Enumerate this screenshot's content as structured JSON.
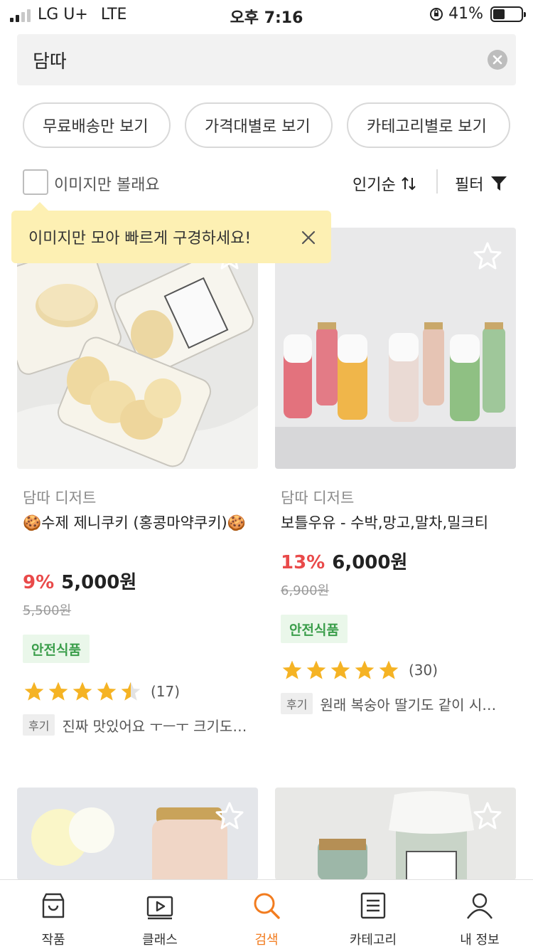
{
  "status_bar": {
    "carrier": "LG U+",
    "network": "LTE",
    "time": "오후 7:16",
    "battery_pct": "41%",
    "battery_level": 0.41
  },
  "search": {
    "value": "담따"
  },
  "chips": [
    {
      "label": "무료배송만 보기"
    },
    {
      "label": "가격대별로 보기"
    },
    {
      "label": "카테고리별로 보기"
    }
  ],
  "options": {
    "only_images_label": "이미지만 볼래요",
    "sort_label": "인기순",
    "filter_label": "필터"
  },
  "tooltip": {
    "text": "이미지만 모아 빠르게 구경하세요!"
  },
  "products": [
    {
      "seller": "담따 디저트",
      "name": "🍪수제 제니쿠키 (홍콩마약쿠키)🍪",
      "discount": "9%",
      "price": "5,000원",
      "original_price": "5,500원",
      "badge": "안전식품",
      "rating": 4.5,
      "rating_count": "(17)",
      "review_tag": "후기",
      "review_text": "진짜 맛있어요 ㅜㅡㅜ 크기도 크고 너무 맛있어요"
    },
    {
      "seller": "담따 디저트",
      "name": "보틀우유 - 수박,망고,말차,밀크티",
      "discount": "13%",
      "price": "6,000원",
      "original_price": "6,900원",
      "badge": "안전식품",
      "rating": 5,
      "rating_count": "(30)",
      "review_tag": "후기",
      "review_text": "원래 복숭아 딸기도 같이 시켰는데 너무 맛있어요"
    }
  ],
  "tabbar": [
    {
      "label": "작품",
      "icon": "shop-icon"
    },
    {
      "label": "클래스",
      "icon": "play-icon"
    },
    {
      "label": "검색",
      "icon": "search-icon",
      "active": true
    },
    {
      "label": "카테고리",
      "icon": "list-icon"
    },
    {
      "label": "내 정보",
      "icon": "person-icon"
    }
  ],
  "colors": {
    "accent": "#f27c1f",
    "discount": "#e94a4a",
    "star": "#f5b324",
    "badge_text": "#3b9e4b",
    "tooltip_bg": "#fdf0b3"
  }
}
